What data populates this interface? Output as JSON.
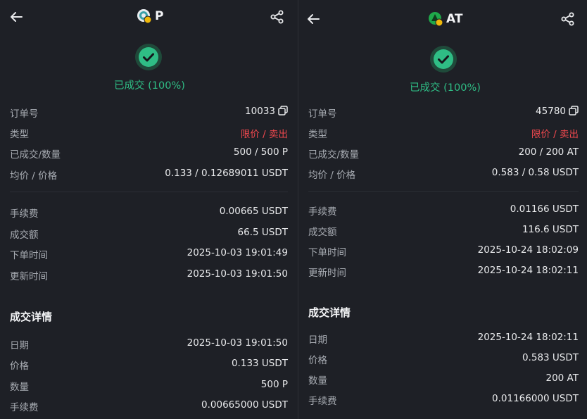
{
  "left": {
    "coin_symbol": "P",
    "status": "已成交 (100%)",
    "rows": [
      {
        "label": "订单号",
        "value": "10033"
      },
      {
        "label": "类型",
        "value": "限价 / 卖出"
      },
      {
        "label": "已成交/数量",
        "value": "500 / 500 P"
      },
      {
        "label": "均价 / 价格",
        "value": "0.133 / 0.12689011 USDT"
      },
      {
        "label": "手续费",
        "value": "0.00665 USDT"
      },
      {
        "label": "成交额",
        "value": "66.5 USDT"
      },
      {
        "label": "下单时间",
        "value": "2025-10-03 19:01:49"
      },
      {
        "label": "更新时间",
        "value": "2025-10-03 19:01:50"
      }
    ],
    "details_title": "成交详情",
    "details": [
      {
        "label": "日期",
        "value": "2025-10-03 19:01:50"
      },
      {
        "label": "价格",
        "value": "0.133 USDT"
      },
      {
        "label": "数量",
        "value": "500 P"
      },
      {
        "label": "手续费",
        "value": "0.00665000 USDT"
      }
    ]
  },
  "right": {
    "coin_symbol": "AT",
    "status": "已成交 (100%)",
    "rows": [
      {
        "label": "订单号",
        "value": "45780"
      },
      {
        "label": "类型",
        "value": "限价 / 卖出"
      },
      {
        "label": "已成交/数量",
        "value": "200 / 200 AT"
      },
      {
        "label": "均价 / 价格",
        "value": "0.583 / 0.58 USDT"
      },
      {
        "label": "手续费",
        "value": "0.01166 USDT"
      },
      {
        "label": "成交额",
        "value": "116.6 USDT"
      },
      {
        "label": "下单时间",
        "value": "2025-10-24 18:02:09"
      },
      {
        "label": "更新时间",
        "value": "2025-10-24 18:02:11"
      }
    ],
    "details_title": "成交详情",
    "details": [
      {
        "label": "日期",
        "value": "2025-10-24 18:02:11"
      },
      {
        "label": "价格",
        "value": "0.583 USDT"
      },
      {
        "label": "数量",
        "value": "200 AT"
      },
      {
        "label": "手续费",
        "value": "0.01166000 USDT"
      }
    ]
  },
  "colors": {
    "background": "#1e2026",
    "success": "#2fbd85",
    "sell": "#f0484e",
    "label": "#a8acb3",
    "value": "#e9eaec"
  },
  "icons": {
    "back": "arrow-left-icon",
    "share": "share-icon",
    "status": "check-circle-icon",
    "copy": "copy-icon"
  }
}
